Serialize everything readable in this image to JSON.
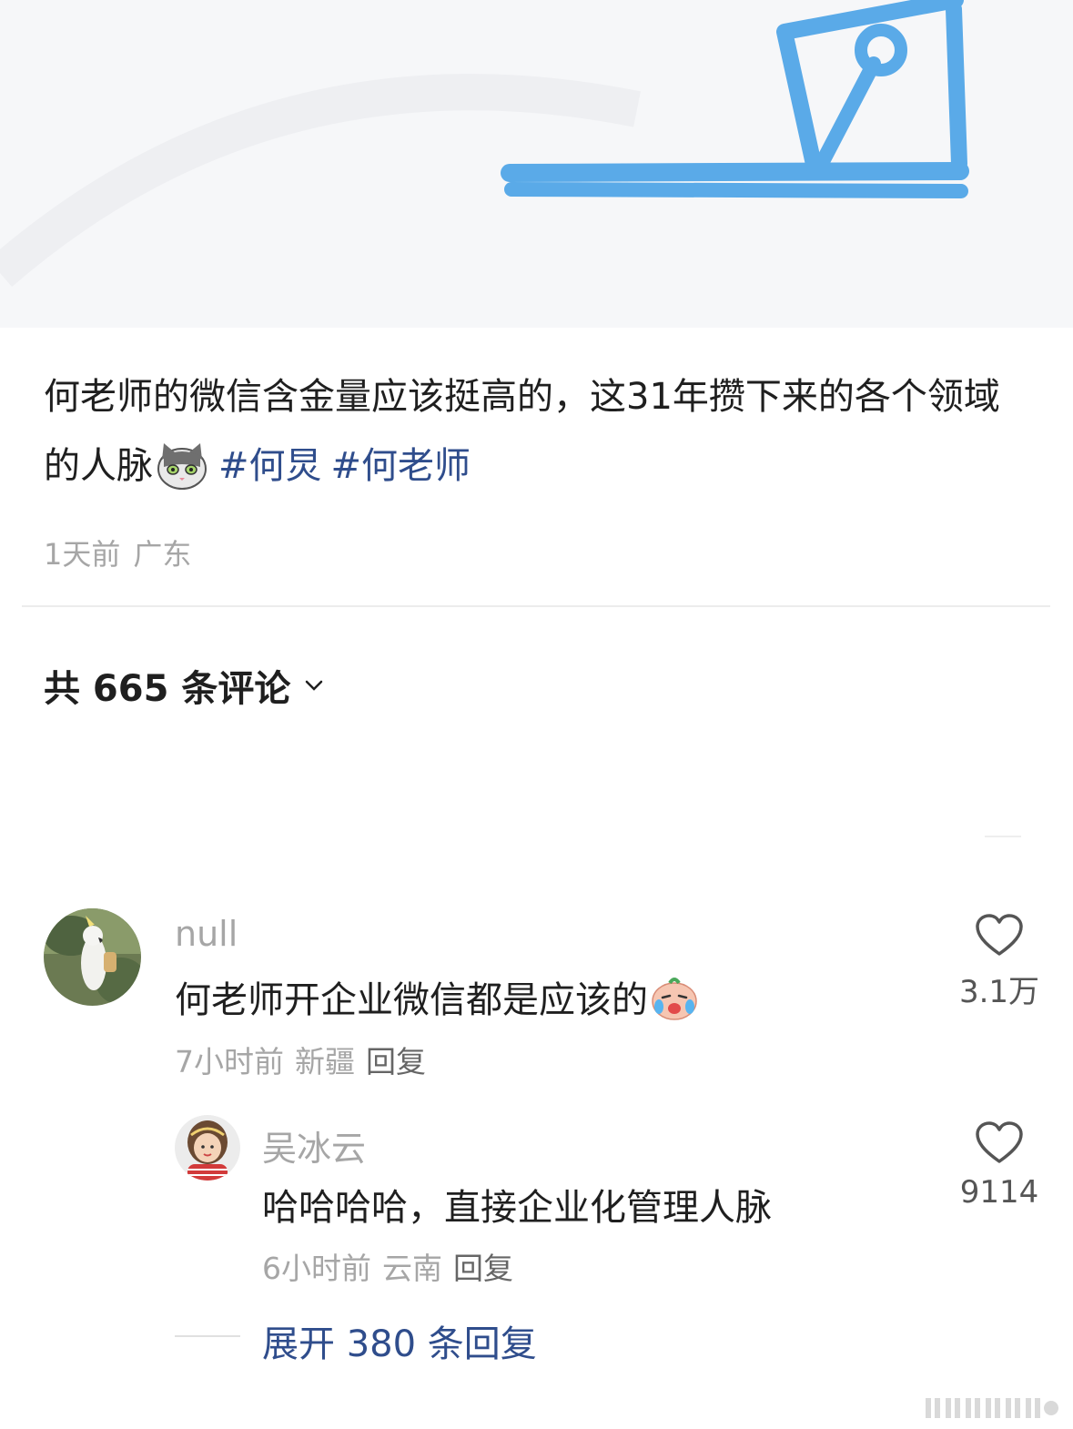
{
  "post": {
    "text": "何老师的微信含金量应该挺高的，这31年攒下来的各个领域的人脉",
    "emoji": "cat-face-emoji",
    "hashtags": [
      "#何炅",
      "#何老师"
    ],
    "time": "1天前",
    "location": "广东"
  },
  "comments_header": {
    "label": "共 665 条评论"
  },
  "comments": [
    {
      "username": "null",
      "text": "何老师开企业微信都是应该的",
      "emoji": "crying-laughing-emoji",
      "time": "7小时前",
      "location": "新疆",
      "reply_label": "回复",
      "likes": "3.1万",
      "avatar": "cockatoo-avatar"
    }
  ],
  "replies": [
    {
      "username": "吴冰云",
      "text": "哈哈哈哈，直接企业化管理人脉",
      "time": "6小时前",
      "location": "云南",
      "reply_label": "回复",
      "likes": "9114",
      "avatar": "child-avatar"
    }
  ],
  "expand_replies": {
    "label": "展开 380 条回复"
  },
  "colors": {
    "link": "#2f4d8c",
    "meta": "#a6a6a6",
    "sketch_blue": "#5aaae8"
  }
}
